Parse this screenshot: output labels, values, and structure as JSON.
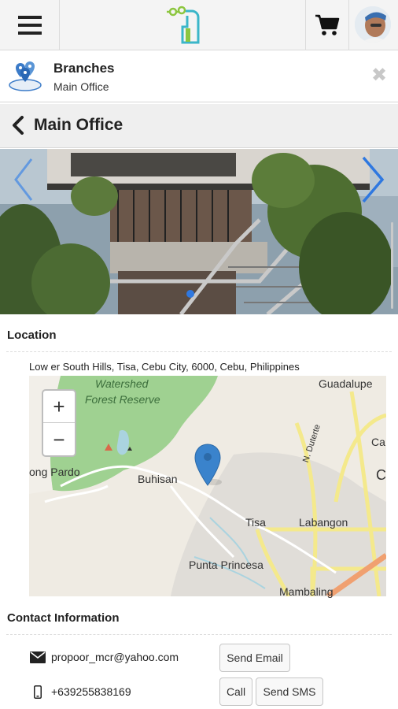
{
  "topbar": {
    "menu_icon": "hamburger-menu-icon",
    "cart_icon": "shopping-cart-icon",
    "accent": "#3bb6c9",
    "logo_green": "#8cc63f"
  },
  "branch": {
    "title": "Branches",
    "subtitle": "Main Office",
    "close": "✖"
  },
  "page": {
    "title": "Main Office"
  },
  "carousel": {
    "arrow_color": "#2f78e0"
  },
  "location": {
    "heading": "Location",
    "address": "Low er South Hills, Tisa, Cebu City, 6000, Cebu, Philippines",
    "zoom_in": "+",
    "zoom_out": "−",
    "labels": {
      "watershed1": "Watershed",
      "watershed2": "Forest Reserve",
      "guadalupe": "Guadalupe",
      "pardo": "ong Pardo",
      "buhisan": "Buhisan",
      "tisa": "Tisa",
      "labangon": "Labangon",
      "punta": "Punta Princesa",
      "mambaling": "Mambaling",
      "duterte": "N. Duterte",
      "ca": "Ca",
      "c": "C"
    }
  },
  "contact": {
    "heading": "Contact Information",
    "email": "propoor_mcr@yahoo.com",
    "phone": "+639255838169",
    "send_email": "Send Email",
    "call": "Call",
    "send_sms": "Send SMS"
  }
}
